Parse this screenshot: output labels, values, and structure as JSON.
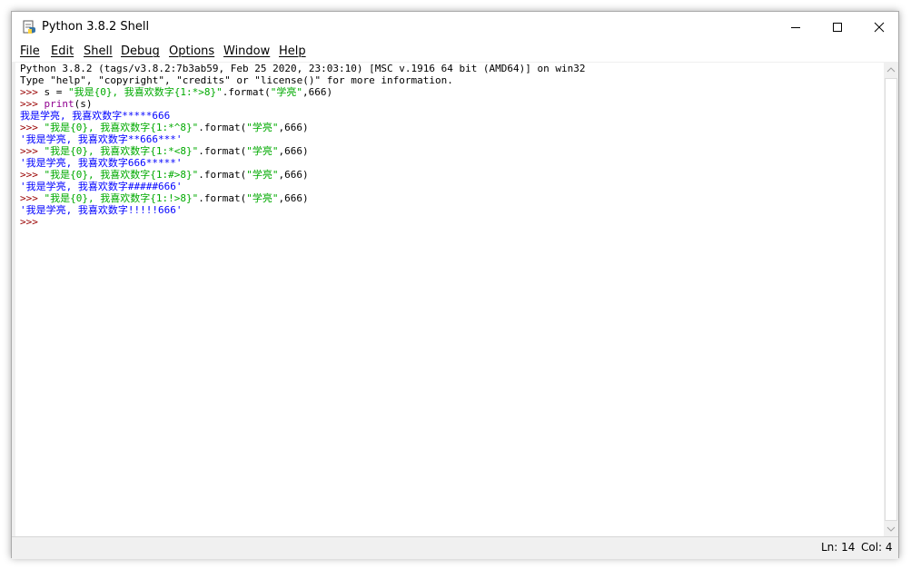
{
  "window": {
    "title": "Python 3.8.2 Shell",
    "icon": "python-idle-icon",
    "controls": [
      "minimize-icon",
      "maximize-icon",
      "close-icon"
    ]
  },
  "menu": [
    "File",
    "Edit",
    "Shell",
    "Debug",
    "Options",
    "Window",
    "Help"
  ],
  "shell": {
    "lines": [
      {
        "segments": [
          {
            "t": "Python 3.8.2 (tags/v3.8.2:7b3ab59, Feb 25 2020, 23:03:10) [MSC v.1916 64 bit (AMD64)] on win32",
            "c": "out"
          }
        ]
      },
      {
        "segments": [
          {
            "t": "Type \"help\", \"copyright\", \"credits\" or \"license()\" for more information.",
            "c": "out"
          }
        ]
      },
      {
        "segments": [
          {
            "t": ">>> ",
            "c": "prompt"
          },
          {
            "t": "s = ",
            "c": "out"
          },
          {
            "t": "\"我是{0}, 我喜欢数字{1:*>8}\"",
            "c": "str"
          },
          {
            "t": ".format(",
            "c": "out"
          },
          {
            "t": "\"学亮\"",
            "c": "str"
          },
          {
            "t": ",666)",
            "c": "out"
          }
        ]
      },
      {
        "segments": [
          {
            "t": ">>> ",
            "c": "prompt"
          },
          {
            "t": "print",
            "c": "builtin"
          },
          {
            "t": "(s)",
            "c": "out"
          }
        ]
      },
      {
        "segments": [
          {
            "t": "我是学亮, 我喜欢数字*****666",
            "c": "stdout"
          }
        ]
      },
      {
        "segments": [
          {
            "t": ">>> ",
            "c": "prompt"
          },
          {
            "t": "\"我是{0}, 我喜欢数字{1:*^8}\"",
            "c": "str"
          },
          {
            "t": ".format(",
            "c": "out"
          },
          {
            "t": "\"学亮\"",
            "c": "str"
          },
          {
            "t": ",666)",
            "c": "out"
          }
        ]
      },
      {
        "segments": [
          {
            "t": "'我是学亮, 我喜欢数字**666***'",
            "c": "res"
          }
        ]
      },
      {
        "segments": [
          {
            "t": ">>> ",
            "c": "prompt"
          },
          {
            "t": "\"我是{0}, 我喜欢数字{1:*<8}\"",
            "c": "str"
          },
          {
            "t": ".format(",
            "c": "out"
          },
          {
            "t": "\"学亮\"",
            "c": "str"
          },
          {
            "t": ",666)",
            "c": "out"
          }
        ]
      },
      {
        "segments": [
          {
            "t": "'我是学亮, 我喜欢数字666*****'",
            "c": "res"
          }
        ]
      },
      {
        "segments": [
          {
            "t": ">>> ",
            "c": "prompt"
          },
          {
            "t": "\"我是{0}, 我喜欢数字{1:#>8}\"",
            "c": "str"
          },
          {
            "t": ".format(",
            "c": "out"
          },
          {
            "t": "\"学亮\"",
            "c": "str"
          },
          {
            "t": ",666)",
            "c": "out"
          }
        ]
      },
      {
        "segments": [
          {
            "t": "'我是学亮, 我喜欢数字#####666'",
            "c": "res"
          }
        ]
      },
      {
        "segments": [
          {
            "t": ">>> ",
            "c": "prompt"
          },
          {
            "t": "\"我是{0}, 我喜欢数字{1:!>8}\"",
            "c": "str"
          },
          {
            "t": ".format(",
            "c": "out"
          },
          {
            "t": "\"学亮\"",
            "c": "str"
          },
          {
            "t": ",666)",
            "c": "out"
          }
        ]
      },
      {
        "segments": [
          {
            "t": "'我是学亮, 我喜欢数字!!!!!666'",
            "c": "res"
          }
        ]
      },
      {
        "segments": [
          {
            "t": ">>> ",
            "c": "prompt"
          }
        ]
      }
    ]
  },
  "status": {
    "line": "Ln: 14",
    "col": "Col: 4"
  },
  "colors": {
    "prompt": "#990000",
    "string": "#00aa00",
    "stdout": "#0000ff",
    "builtin": "#900090"
  }
}
